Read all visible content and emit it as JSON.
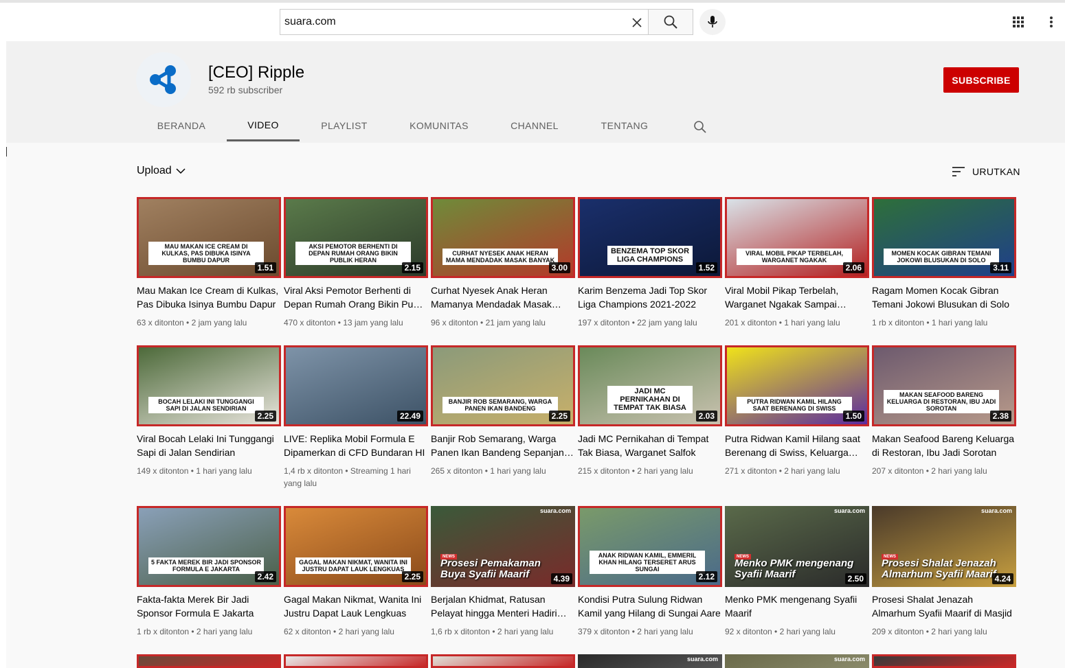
{
  "search": {
    "value": "suara.com",
    "clear_icon": "close-icon",
    "search_icon": "search-icon",
    "mic_icon": "mic-icon"
  },
  "header_icons": {
    "apps_icon": "apps-grid-icon",
    "more_icon": "more-vert-icon"
  },
  "channel": {
    "name": "[CEO] Ripple",
    "subscribers": "592 rb subscriber",
    "subscribe_label": "SUBSCRIBE",
    "brand_color": "#0a6cc7"
  },
  "tabs": [
    {
      "label": "BERANDA",
      "active": false
    },
    {
      "label": "VIDEO",
      "active": true
    },
    {
      "label": "PLAYLIST",
      "active": false
    },
    {
      "label": "KOMUNITAS",
      "active": false
    },
    {
      "label": "CHANNEL",
      "active": false
    },
    {
      "label": "TENTANG",
      "active": false
    }
  ],
  "filter": {
    "upload_label": "Upload",
    "sort_label": "URUTKAN"
  },
  "colors": {
    "subscribe": "#cc0000",
    "thumb_border": "#c62828"
  },
  "videos": [
    {
      "caption": "MAU MAKAN ICE CREAM DI KULKAS, PAS DIBUKA ISINYA BUMBU DAPUR",
      "duration": "1.51",
      "title": "Mau Makan Ice Cream di Kulkas, Pas Dibuka Isinya Bumbu Dapur",
      "views": "63 x ditonton",
      "age": "2 jam yang lalu",
      "palette": [
        "#a08060",
        "#6b4a2e"
      ]
    },
    {
      "caption": "AKSI PEMOTOR BERHENTI DI DEPAN RUMAH ORANG BIKIN PUBLIK HERAN",
      "duration": "2.15",
      "title": "Viral Aksi Pemotor Berhenti di Depan Rumah Orang Bikin Publik Heran",
      "views": "470 x ditonton",
      "age": "13 jam yang lalu",
      "palette": [
        "#5a7a4a",
        "#2c3a2a"
      ]
    },
    {
      "caption": "CURHAT NYESEK ANAK HERAN MAMA MENDADAK MASAK BANYAK",
      "duration": "3.00",
      "title": "Curhat Nyesek Anak Heran Mamanya Mendadak Masak Banyak",
      "views": "96 x ditonton",
      "age": "21 jam yang lalu",
      "palette": [
        "#6f8b3a",
        "#b33a2a"
      ]
    },
    {
      "caption": "BENZEMA TOP SKOR LIGA CHAMPIONS",
      "duration": "1.52",
      "title": "Karim Benzema Jadi Top Skor Liga Champions 2021-2022",
      "views": "197 x ditonton",
      "age": "22 jam yang lalu",
      "palette": [
        "#1a2f6b",
        "#0c1838"
      ]
    },
    {
      "caption": "VIRAL MOBIL PIKAP TERBELAH, WARGANET NGAKAK",
      "duration": "2.06",
      "title": "Viral Mobil Pikap Terbelah, Warganet Ngakak Sampai Terpingkal",
      "views": "201 x ditonton",
      "age": "1 hari yang lalu",
      "palette": [
        "#d9e2e8",
        "#b32020"
      ]
    },
    {
      "caption": "MOMEN KOCAK GIBRAN TEMANI JOKOWI BLUSUKAN DI SOLO",
      "duration": "3.11",
      "title": "Ragam Momen Kocak Gibran Temani Jokowi Blusukan di Solo",
      "views": "1 rb x ditonton",
      "age": "1 hari yang lalu",
      "palette": [
        "#2e6f3a",
        "#1f3f8a"
      ]
    },
    {
      "caption": "BOCAH LELAKI INI TUNGGANGI SAPI DI JALAN SENDIRIAN",
      "duration": "2.25",
      "title": "Viral Bocah Lelaki Ini Tunggangi Sapi di Jalan Sendirian",
      "views": "149 x ditonton",
      "age": "1 hari yang lalu",
      "palette": [
        "#4d6a3a",
        "#e8e4dc"
      ]
    },
    {
      "caption": "",
      "duration": "22.49",
      "title": "LIVE: Replika Mobil Formula E Dipamerkan di CFD Bundaran HI",
      "views": "1,4 rb x ditonton",
      "age": "Streaming 1 hari yang lalu",
      "palette": [
        "#7e93a8",
        "#3d5266"
      ]
    },
    {
      "caption": "BANJIR ROB SEMARANG, WARGA PANEN IKAN BANDENG",
      "duration": "2.25",
      "title": "Banjir Rob Semarang, Warga Panen Ikan Bandeng Sepanjang Jalan",
      "views": "265 x ditonton",
      "age": "1 hari yang lalu",
      "palette": [
        "#8b9a7a",
        "#c8b06a"
      ]
    },
    {
      "caption": "JADI MC PERNIKAHAN DI TEMPAT TAK BIASA",
      "duration": "2.03",
      "title": "Jadi MC Pernikahan di Tempat Tak Biasa, Warganet Salfok",
      "views": "215 x ditonton",
      "age": "2 hari yang lalu",
      "palette": [
        "#6a8a5a",
        "#c9c2b0"
      ]
    },
    {
      "caption": "PUTRA RIDWAN KAMIL HILANG SAAT BERENANG DI SWISS",
      "duration": "1.50",
      "title": "Putra Ridwan Kamil Hilang saat Berenang di Swiss, Keluarga Minta Doa",
      "views": "271 x ditonton",
      "age": "2 hari yang lalu",
      "palette": [
        "#f0e21a",
        "#5b2ba0"
      ]
    },
    {
      "caption": "MAKAN SEAFOOD BARENG KELUARGA DI RESTORAN, IBU JADI SOROTAN",
      "duration": "2.38",
      "title": "Makan Seafood Bareng Keluarga di Restoran, Ibu Jadi Sorotan",
      "views": "207 x ditonton",
      "age": "2 hari yang lalu",
      "palette": [
        "#6d5a6e",
        "#b89a8a"
      ]
    },
    {
      "caption": "5 FAKTA MEREK BIR JADI SPONSOR FORMULA E JAKARTA",
      "duration": "2.42",
      "title": "Fakta-fakta Merek Bir Jadi Sponsor Formula E Jakarta",
      "views": "1 rb x ditonton",
      "age": "2 hari yang lalu",
      "palette": [
        "#8aa0b8",
        "#4a5f48"
      ]
    },
    {
      "caption": "GAGAL MAKAN NIKMAT, WANITA INI JUSTRU DAPAT LAUK LENGKUAS",
      "duration": "2.25",
      "title": "Gagal Makan Nikmat, Wanita Ini Justru Dapat Lauk Lengkuas",
      "views": "62 x ditonton",
      "age": "2 hari yang lalu",
      "palette": [
        "#d98a3a",
        "#8a4a1a"
      ]
    },
    {
      "caption": "",
      "news": "NEWS",
      "news_title": "Prosesi Pemakaman Buya Syafii Maarif",
      "logo": "suara.com",
      "duration": "4.39",
      "title": "Berjalan Khidmat, Ratusan Pelayat hingga Menteri Hadiri Pemakaman",
      "views": "1,6 rb x ditonton",
      "age": "2 hari yang lalu",
      "palette": [
        "#3a5a3a",
        "#7a2a2a"
      ]
    },
    {
      "caption": "ANAK RIDWAN KAMIL, EMMERIL KHAN HILANG TERSERET ARUS SUNGAI",
      "duration": "2.12",
      "title": "Kondisi Putra Sulung Ridwan Kamil yang Hilang di Sungai Aare",
      "views": "379 x ditonton",
      "age": "2 hari yang lalu",
      "palette": [
        "#7a9a6a",
        "#4a6a8a"
      ]
    },
    {
      "caption": "",
      "news": "NEWS",
      "news_title": "Menko PMK mengenang Syafii Maarif",
      "logo": "suara.com",
      "duration": "2.50",
      "title": "Menko PMK mengenang Syafii Maarif",
      "views": "92 x ditonton",
      "age": "2 hari yang lalu",
      "palette": [
        "#5a6a4a",
        "#2a2a2a"
      ]
    },
    {
      "caption": "",
      "news": "NEWS",
      "news_title": "Prosesi Shalat Jenazah Almarhum Syafii Maarif",
      "logo": "suara.com",
      "duration": "4.24",
      "title": "Prosesi Shalat Jenazah Almarhum Syafii Maarif di Masjid",
      "views": "209 x ditonton",
      "age": "2 hari yang lalu",
      "palette": [
        "#4a3a2a",
        "#c8a040"
      ]
    }
  ],
  "partial_row": [
    {
      "palette": [
        "#6a4a3a",
        "#c62828"
      ],
      "logo": ""
    },
    {
      "palette": [
        "#e8e8e8",
        "#c62828"
      ],
      "logo": ""
    },
    {
      "palette": [
        "#e0e0d8",
        "#c62828"
      ],
      "logo": ""
    },
    {
      "palette": [
        "#2a2a2a",
        "#555555"
      ],
      "logo": "suara.com"
    },
    {
      "palette": [
        "#6a6a4a",
        "#8a8a6a"
      ],
      "logo": "suara.com"
    },
    {
      "palette": [
        "#3a3a3a",
        "#c62828"
      ],
      "logo": ""
    }
  ]
}
